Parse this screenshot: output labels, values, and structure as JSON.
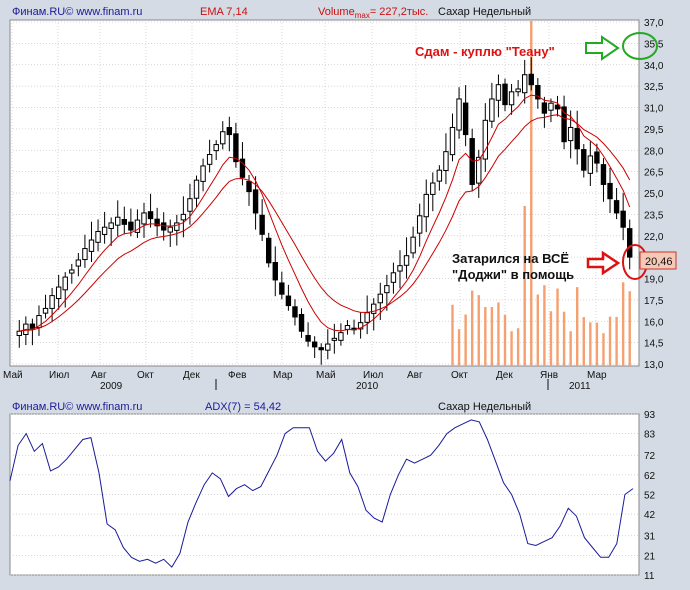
{
  "top_panel": {
    "source_label": "Финам.RU©  www.finam.ru",
    "ema_label": "EMA 7,14",
    "volume_label_prefix": "Volume",
    "volume_label_sub": "max",
    "volume_label_value": "= 227,2тыс.",
    "instrument": "Сахар Недельный",
    "annotation_sell": "Сдам - куплю \"Теану\"",
    "annotation_buy_line1": "Затарился на ВСЁ",
    "annotation_buy_line2": "\"Доджи\" в помощь",
    "last_price_label": "20,46"
  },
  "bottom_panel": {
    "source_label": "Финам.RU©  www.finam.ru",
    "adx_label": "ADX(7) = 54,42",
    "instrument": "Сахар Недельный"
  },
  "colors": {
    "background": "#d4dbe4",
    "plot_background": "#ffffff",
    "grid": "#c8c8c8",
    "candle": "#000000",
    "ema_line": "#cc0000",
    "volume_bar": "#f4a070",
    "adx_line": "#1a1a99",
    "annotation_red": "#dd1111",
    "annotation_green": "#22aa22",
    "header_blue": "#1a1a99",
    "header_red": "#cc1111"
  },
  "chart_data": [
    {
      "type": "candlestick",
      "title": "Сахар Недельный",
      "y_ticks": [
        "37,0",
        "35,5",
        "34,0",
        "32,5",
        "31,0",
        "29,5",
        "28,0",
        "26,5",
        "25,0",
        "23,5",
        "22,0",
        "20,5",
        "19,0",
        "17,5",
        "16,0",
        "14,5",
        "13,0"
      ],
      "ylim": [
        13.0,
        37.0
      ],
      "x_tick_labels": [
        "Май",
        "Июл",
        "Авг",
        "Окт",
        "Дек",
        "Фев",
        "Мар",
        "Май",
        "Июл",
        "Авг",
        "Окт",
        "Дек",
        "Янв",
        "Мар"
      ],
      "year_labels": [
        "2009",
        "2010",
        "2011"
      ],
      "series": [
        {
          "name": "EMA 7"
        },
        {
          "name": "EMA 14"
        }
      ],
      "close_sample": [
        15.3,
        15.8,
        15.5,
        16.4,
        16.9,
        17.8,
        18.4,
        19.1,
        19.6,
        20.3,
        21.1,
        21.7,
        22.3,
        22.6,
        22.9,
        23.3,
        22.8,
        22.4,
        23.1,
        23.6,
        23.2,
        22.7,
        22.4,
        22.6,
        22.9,
        23.5,
        24.6,
        25.9,
        26.9,
        27.7,
        28.4,
        29.3,
        29.1,
        27.2,
        26.1,
        25.1,
        23.6,
        22.1,
        20.1,
        18.9,
        17.9,
        17.1,
        16.3,
        15.3,
        14.6,
        14.2,
        14.0,
        14.4,
        14.8,
        15.2,
        15.7,
        15.4,
        15.9,
        16.6,
        17.2,
        17.9,
        18.5,
        19.4,
        19.9,
        20.6,
        21.9,
        23.4,
        24.9,
        25.7,
        26.6,
        27.9,
        29.6,
        31.6,
        29.1,
        25.6,
        27.5,
        30.1,
        31.6,
        32.6,
        31.2,
        32.1,
        32.3,
        33.3,
        32.6,
        31.6,
        30.6,
        31.3,
        30.9,
        28.6,
        29.6,
        28.1,
        26.6,
        27.6,
        27.1,
        25.6,
        24.6,
        23.6,
        22.6,
        20.5
      ],
      "volume_max": "227,2тыс.",
      "annotations": [
        "Сдам - куплю \"Теану\"",
        "Затарился на ВСЁ",
        "\"Доджи\" в помощь"
      ],
      "last_price": 20.46
    },
    {
      "type": "line",
      "title": "ADX(7) = 54,42",
      "y_ticks": [
        "93",
        "83",
        "72",
        "62",
        "52",
        "42",
        "31",
        "21",
        "11"
      ],
      "ylim": [
        11,
        93
      ],
      "series": [
        {
          "name": "ADX(7)",
          "values": [
            59,
            77,
            83,
            74,
            78,
            64,
            66,
            70,
            75,
            80,
            81,
            63,
            37,
            34,
            25,
            20,
            18,
            19,
            17,
            19,
            15,
            22,
            38,
            48,
            57,
            63,
            60,
            51,
            55,
            57,
            54,
            56,
            64,
            72,
            83,
            86,
            86,
            86,
            74,
            69,
            73,
            80,
            63,
            56,
            44,
            40,
            38,
            52,
            62,
            70,
            68,
            70,
            72,
            77,
            83,
            86,
            88,
            90,
            89,
            80,
            69,
            58,
            52,
            42,
            27,
            26,
            28,
            30,
            36,
            45,
            41,
            30,
            25,
            20,
            20,
            27,
            52,
            55
          ]
        }
      ],
      "last_value": 54.42
    }
  ]
}
